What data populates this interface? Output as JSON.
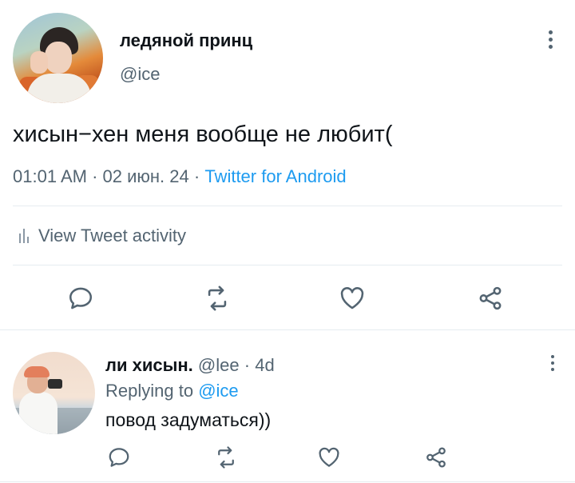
{
  "tweet": {
    "author_name": "ледяной принц",
    "author_handle": "@ice",
    "text": "хисын−хен меня вообще не любит(",
    "time": "01:01 AM",
    "separator": "·",
    "date": "02 июн. 24",
    "source": "Twitter for Android",
    "activity_label": "View Tweet activity"
  },
  "reply": {
    "author_name": "ли хисын.",
    "author_handle": "@lee",
    "age": "4d",
    "replying_prefix": "Replying to",
    "replying_to": "@ice",
    "text": "повод задуматься))"
  },
  "icons": {
    "reply": "reply-icon",
    "retweet": "retweet-icon",
    "like": "heart-icon",
    "share": "share-icon",
    "more": "more-vertical-icon",
    "activity": "bar-chart-icon"
  },
  "colors": {
    "accent": "#1d9bf0",
    "secondary_text": "#536471",
    "icon": "#536471",
    "divider": "#e6ecf0"
  }
}
